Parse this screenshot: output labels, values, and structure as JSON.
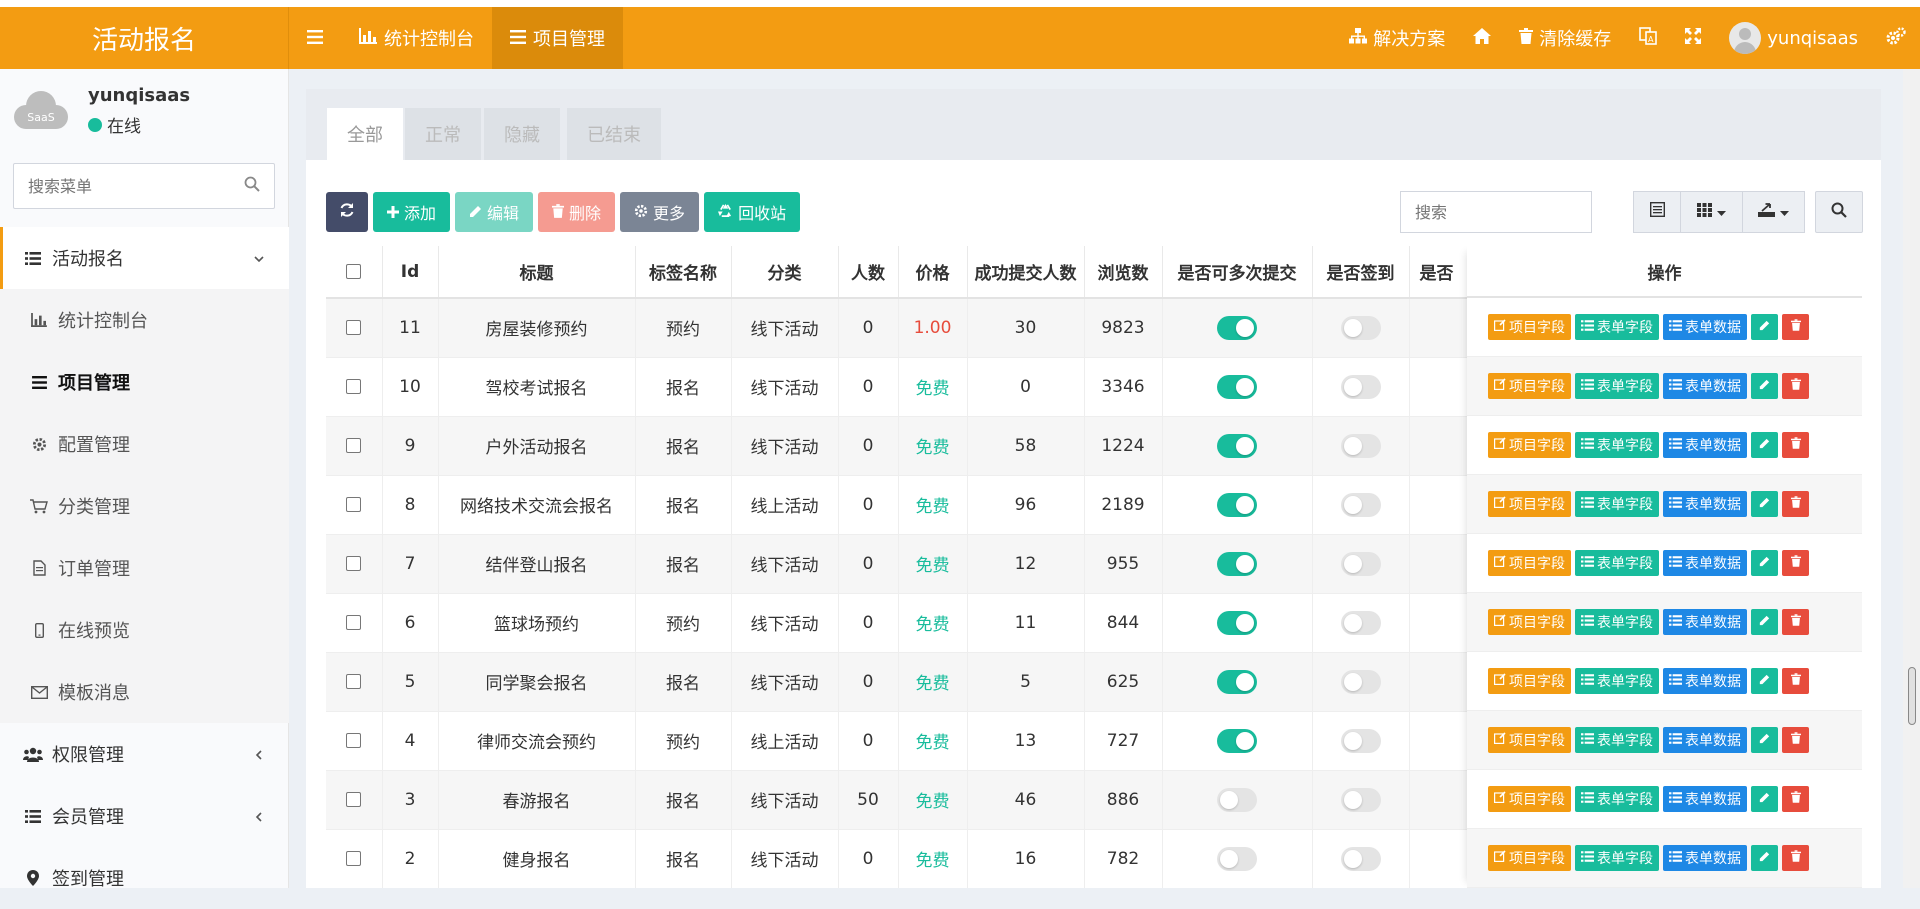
{
  "header": {
    "brand": "活动报名",
    "nav": [
      {
        "label": "统计控制台"
      },
      {
        "label": "项目管理"
      }
    ],
    "right": {
      "solutions": "解决方案",
      "clear_cache": "清除缓存",
      "username": "yunqisaas"
    }
  },
  "sidebar": {
    "user": {
      "name": "yunqisaas",
      "status": "在线",
      "avatar_text": "SaaS"
    },
    "search_placeholder": "搜索菜单",
    "menu": [
      {
        "label": "活动报名"
      },
      {
        "label": "统计控制台"
      },
      {
        "label": "项目管理"
      },
      {
        "label": "配置管理"
      },
      {
        "label": "分类管理"
      },
      {
        "label": "订单管理"
      },
      {
        "label": "在线预览"
      },
      {
        "label": "模板消息"
      },
      {
        "label": "权限管理"
      },
      {
        "label": "会员管理"
      },
      {
        "label": "签到管理"
      }
    ]
  },
  "tabs": [
    "全部",
    "正常",
    "隐藏",
    "已结束"
  ],
  "toolbar": {
    "add": "添加",
    "edit": "编辑",
    "delete": "删除",
    "more": "更多",
    "recycle": "回收站",
    "search_placeholder": "搜索"
  },
  "table": {
    "columns": [
      "Id",
      "标题",
      "标签名称",
      "分类",
      "人数",
      "价格",
      "成功提交人数",
      "浏览数",
      "是否可多次提交",
      "是否签到",
      "是否"
    ],
    "ops_header": "操作",
    "ops_labels": {
      "project_fields": "项目字段",
      "form_fields": "表单字段",
      "form_data": "表单数据"
    },
    "rows": [
      {
        "id": "11",
        "title": "房屋装修预约",
        "tag": "预约",
        "category": "线下活动",
        "people": "0",
        "price": "1.00",
        "price_free": false,
        "submitted": "30",
        "views": "9823",
        "multi": true,
        "signin": false
      },
      {
        "id": "10",
        "title": "驾校考试报名",
        "tag": "报名",
        "category": "线下活动",
        "people": "0",
        "price": "免费",
        "price_free": true,
        "submitted": "0",
        "views": "3346",
        "multi": true,
        "signin": false
      },
      {
        "id": "9",
        "title": "户外活动报名",
        "tag": "报名",
        "category": "线下活动",
        "people": "0",
        "price": "免费",
        "price_free": true,
        "submitted": "58",
        "views": "1224",
        "multi": true,
        "signin": false
      },
      {
        "id": "8",
        "title": "网络技术交流会报名",
        "tag": "报名",
        "category": "线上活动",
        "people": "0",
        "price": "免费",
        "price_free": true,
        "submitted": "96",
        "views": "2189",
        "multi": true,
        "signin": false
      },
      {
        "id": "7",
        "title": "结伴登山报名",
        "tag": "报名",
        "category": "线下活动",
        "people": "0",
        "price": "免费",
        "price_free": true,
        "submitted": "12",
        "views": "955",
        "multi": true,
        "signin": false
      },
      {
        "id": "6",
        "title": "篮球场预约",
        "tag": "预约",
        "category": "线下活动",
        "people": "0",
        "price": "免费",
        "price_free": true,
        "submitted": "11",
        "views": "844",
        "multi": true,
        "signin": false
      },
      {
        "id": "5",
        "title": "同学聚会报名",
        "tag": "报名",
        "category": "线下活动",
        "people": "0",
        "price": "免费",
        "price_free": true,
        "submitted": "5",
        "views": "625",
        "multi": true,
        "signin": false
      },
      {
        "id": "4",
        "title": "律师交流会预约",
        "tag": "预约",
        "category": "线上活动",
        "people": "0",
        "price": "免费",
        "price_free": true,
        "submitted": "13",
        "views": "727",
        "multi": true,
        "signin": false
      },
      {
        "id": "3",
        "title": "春游报名",
        "tag": "报名",
        "category": "线下活动",
        "people": "50",
        "price": "免费",
        "price_free": true,
        "submitted": "46",
        "views": "886",
        "multi": false,
        "signin": false
      },
      {
        "id": "2",
        "title": "健身报名",
        "tag": "报名",
        "category": "线下活动",
        "people": "0",
        "price": "免费",
        "price_free": true,
        "submitted": "16",
        "views": "782",
        "multi": false,
        "signin": false
      }
    ]
  },
  "colors": {
    "brand": "#f39c12",
    "success": "#18bc9c",
    "danger": "#e74c3c",
    "primary": "#1e88e5"
  }
}
